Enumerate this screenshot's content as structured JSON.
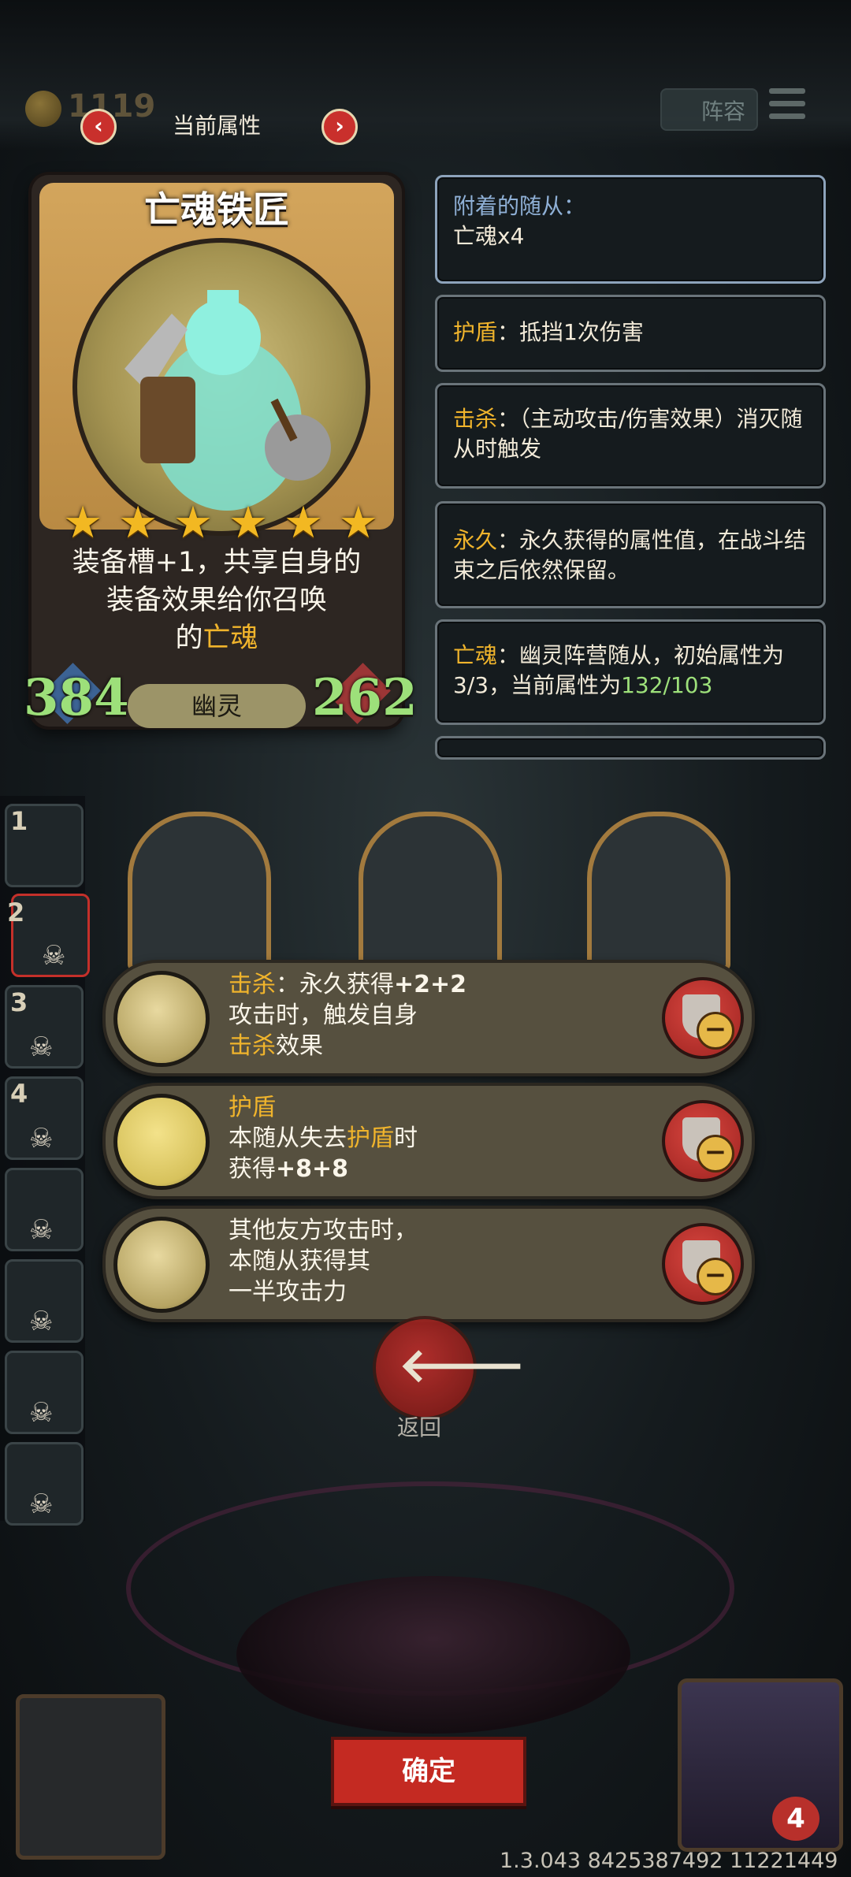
{
  "topbar": {
    "coins": "1119",
    "title": "当前属性",
    "lineup_label": "阵容"
  },
  "card": {
    "name": "亡魂铁匠",
    "stars": 6,
    "star_glyph": "★",
    "desc_line1": "装备槽+1，共享自身的",
    "desc_line2": "装备效果给你召唤",
    "desc_line3_pre": "的",
    "desc_line3_hl": "亡魂",
    "attack": "384",
    "health": "262",
    "tribe": "幽灵"
  },
  "panels": {
    "attached_title": "附着的随从：",
    "attached_value": "亡魂x4",
    "shield_kw": "护盾",
    "shield_text": "：抵挡1次伤害",
    "kill_kw": "击杀",
    "kill_text": "：（主动攻击/伤害效果）消灭随从时触发",
    "perm_kw": "永久",
    "perm_text": "：永久获得的属性值，在战斗结束之后依然保留。",
    "soul_kw": "亡魂",
    "soul_text": "：幽灵阵营随从，初始属性为3/3，当前属性为",
    "soul_current": "132/103"
  },
  "roster": {
    "slots": [
      "1",
      "2",
      "3",
      "4",
      "",
      "",
      "",
      ""
    ],
    "skull_glyph": "☠"
  },
  "abilities": [
    {
      "line1_kw": "击杀",
      "line1_rest": "：永久获得",
      "line1_bold": "+2+2",
      "line2": "攻击时，触发自身",
      "line3_kw": "击杀",
      "line3_rest": "效果"
    },
    {
      "title_kw": "护盾",
      "line2_pre": "本随从失去",
      "line2_kw": "护盾",
      "line2_post": "时",
      "line3_pre": "获得",
      "line3_bold": "+8+8"
    },
    {
      "line1": "其他友方攻击时，",
      "line2": "本随从获得其",
      "line3": "一半攻击力"
    }
  ],
  "minus_glyph": "−",
  "back": {
    "arrow": "🡐",
    "label": "返回"
  },
  "confirm_label": "确定",
  "version": "1.3.043 8425387492 11221449",
  "lives": "4",
  "colors": {
    "keyword": "#f0b42c",
    "stat": "#9de07a",
    "button_red": "#c42a22",
    "panel_border": "#6a747a",
    "card_gold": "#c99a50"
  }
}
